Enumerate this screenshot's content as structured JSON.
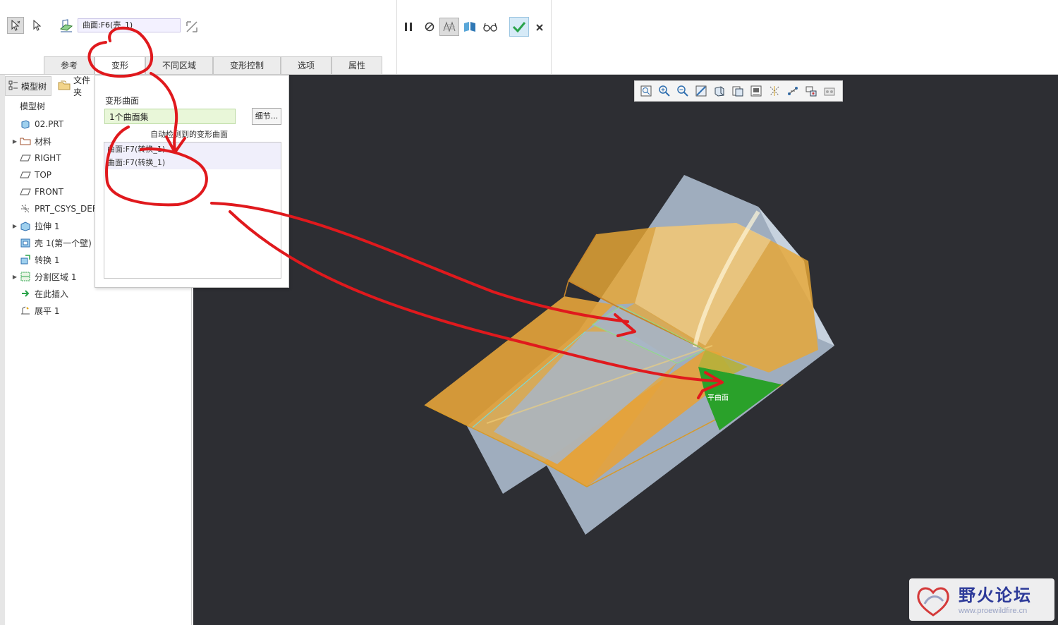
{
  "dashboard": {
    "collector_value": "曲面:F6(壳_1)",
    "tabs": [
      {
        "label": "参考",
        "active": false
      },
      {
        "label": "变形",
        "active": true
      },
      {
        "label": "不同区域",
        "active": false
      },
      {
        "label": "变形控制",
        "active": false
      },
      {
        "label": "选项",
        "active": false
      },
      {
        "label": "属性",
        "active": false
      }
    ],
    "icons": [
      "smart-select-icon",
      "arrow-select-icon",
      "surface-ref-icon",
      "flip-direction-icon",
      "pause-icon",
      "stop-icon",
      "mesh-preview-icon",
      "geometry-preview-icon",
      "glasses-preview-icon",
      "ok-check-icon",
      "cancel-x-icon"
    ],
    "accent_color": "#2aa34a"
  },
  "panel": {
    "deform_surfaces_label": "变形曲面",
    "deform_surfaces_value": "1个曲面集",
    "details_button": "细节...",
    "auto_detected_label": "自动检测到的变形曲面",
    "auto_detected_items": [
      "曲面:F7(转换_1)",
      "曲面:F7(转换_1)"
    ]
  },
  "sidebar": {
    "tabs": [
      {
        "label": "模型树",
        "icon": "model-tree-icon"
      },
      {
        "label": "文件夹",
        "icon": "folder-icon"
      }
    ],
    "header": "模型树",
    "tree": [
      {
        "label": "02.PRT",
        "icon": "part-icon",
        "expandable": false
      },
      {
        "label": "材料",
        "icon": "material-icon",
        "expandable": true
      },
      {
        "label": "RIGHT",
        "icon": "datum-plane-icon",
        "expandable": false
      },
      {
        "label": "TOP",
        "icon": "datum-plane-icon",
        "expandable": false
      },
      {
        "label": "FRONT",
        "icon": "datum-plane-icon",
        "expandable": false
      },
      {
        "label": "PRT_CSYS_DEF",
        "icon": "csys-icon",
        "expandable": false
      },
      {
        "label": "拉伸 1",
        "icon": "extrude-icon",
        "expandable": true
      },
      {
        "label": "壳 1(第一个壁)",
        "icon": "shell-icon",
        "expandable": false
      },
      {
        "label": "转换 1",
        "icon": "convert-icon",
        "expandable": false
      },
      {
        "label": "分割区域 1",
        "icon": "split-area-icon",
        "expandable": true
      },
      {
        "label": "在此插入",
        "icon": "insert-here-icon",
        "expandable": false
      },
      {
        "label": "展平 1",
        "icon": "flatten-icon",
        "expandable": false
      }
    ]
  },
  "graphics": {
    "background_color": "#2d2e33",
    "view_toolbar_icons": [
      "refit-icon",
      "zoom-in-icon",
      "zoom-out-icon",
      "repaint-icon",
      "display-style-icon",
      "saved-views-icon",
      "view-manager-icon",
      "datum-display-icon",
      "spin-center-icon",
      "annotation-display-icon",
      "appearance-icon"
    ],
    "model_label": "平曲面",
    "model_colors": {
      "shell": "#e2a23a",
      "base": "#a5b4c6",
      "selected": "#2aa12a"
    },
    "annotation_color": "#e0191d"
  },
  "watermark": {
    "title": "野火论坛",
    "url": "www.proewildfire.cn"
  }
}
